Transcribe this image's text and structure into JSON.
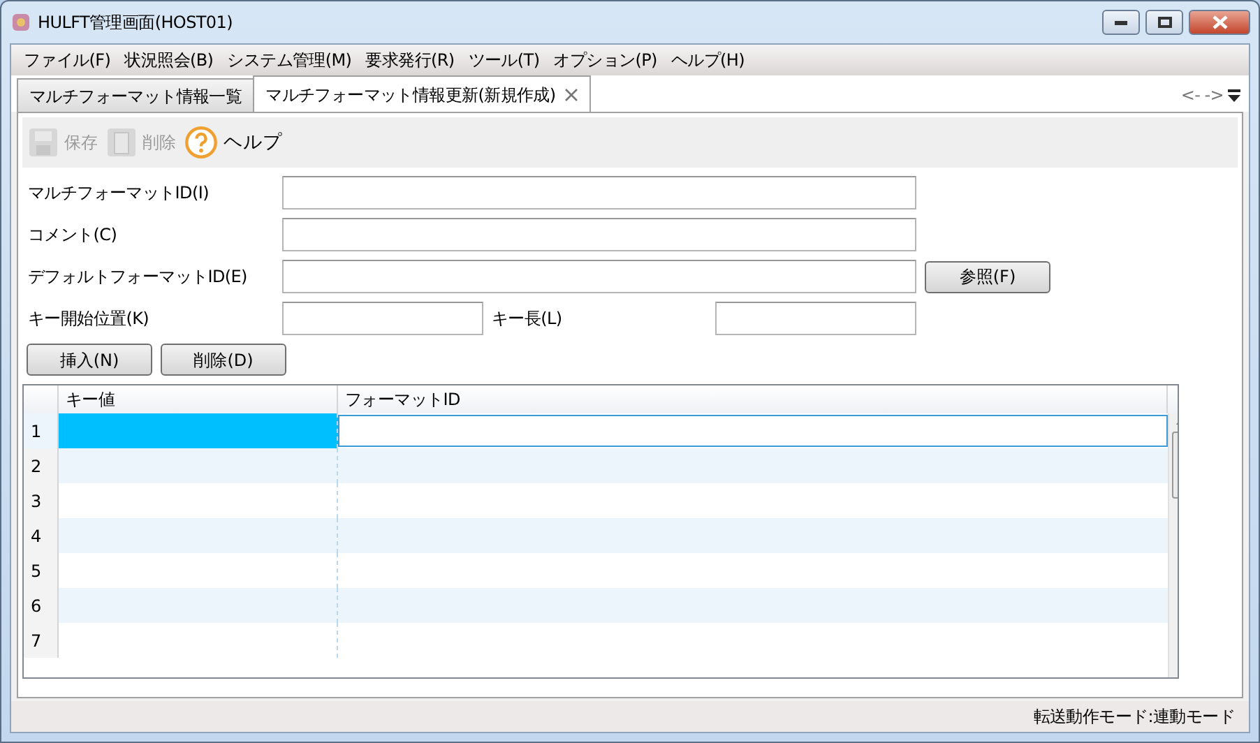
{
  "window": {
    "title": "HULFT管理画面(HOST01)"
  },
  "menu": [
    "ファイル(F)",
    "状況照会(B)",
    "システム管理(M)",
    "要求発行(R)",
    "ツール(T)",
    "オプション(P)",
    "ヘルプ(H)"
  ],
  "tabs": [
    {
      "label": "マルチフォーマット情報一覧",
      "selected": false,
      "closable": false
    },
    {
      "label": "マルチフォーマット情報更新(新規作成)",
      "selected": true,
      "closable": true
    }
  ],
  "tab_nav": {
    "back": "<-",
    "forward": "->"
  },
  "toolbar": [
    {
      "kind": "save",
      "label": "保存",
      "disabled": true
    },
    {
      "kind": "delete",
      "label": "削除",
      "disabled": true
    },
    {
      "kind": "help",
      "label": "ヘルプ",
      "disabled": false
    }
  ],
  "form": {
    "multi_format_id": {
      "label": "マルチフォーマットID(I)"
    },
    "comment": {
      "label": "コメント(C)"
    },
    "default_format_id": {
      "label": "デフォルトフォーマットID(E)",
      "button": "参照(F)"
    },
    "key_start": {
      "label": "キー開始位置(K)"
    },
    "key_length": {
      "label": "キー長(L)"
    }
  },
  "row_buttons": [
    "挿入(N)",
    "削除(D)"
  ],
  "grid": {
    "columns": [
      "キー値",
      "フォーマットID"
    ],
    "rows": [
      {
        "number": "1",
        "selected": true,
        "editing": true
      },
      {
        "number": "2",
        "selected": false,
        "editing": false
      },
      {
        "number": "3",
        "selected": false,
        "editing": false
      },
      {
        "number": "4",
        "selected": false,
        "editing": false
      },
      {
        "number": "5",
        "selected": false,
        "editing": false
      },
      {
        "number": "6",
        "selected": false,
        "editing": false
      },
      {
        "number": "7",
        "selected": false,
        "editing": false
      }
    ]
  },
  "status_bar": "転送動作モード:連動モード"
}
